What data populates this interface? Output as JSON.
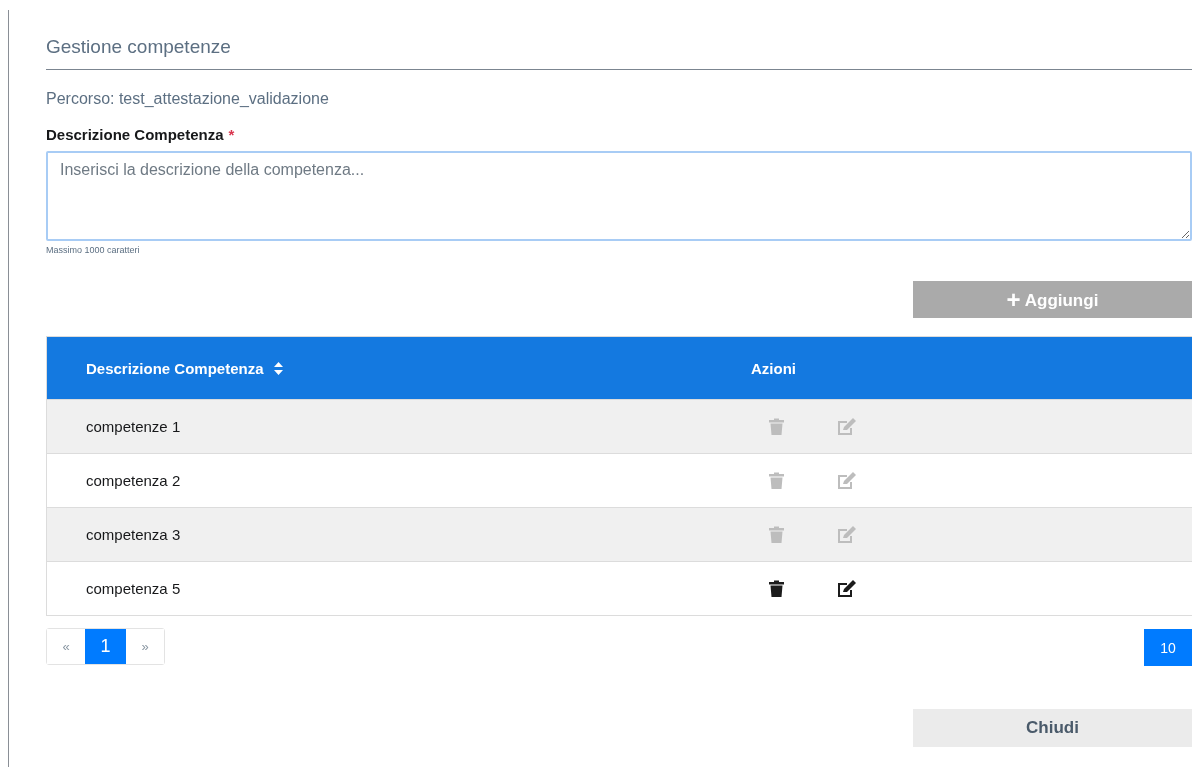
{
  "title": "Gestione competenze",
  "path_text": "Percorso: test_attestazione_validazione",
  "field": {
    "label": "Descrizione Competenza",
    "required_mark": "*",
    "placeholder": "Inserisci la descrizione della competenza...",
    "hint": "Massimo 1000 caratteri"
  },
  "add_button": {
    "icon": "+",
    "label": "Aggiungi",
    "disabled": true
  },
  "table": {
    "columns": [
      "Descrizione Competenza",
      "Azioni"
    ],
    "rows": [
      {
        "description": "competenze 1",
        "actions_disabled": true
      },
      {
        "description": "competenza 2",
        "actions_disabled": true
      },
      {
        "description": "competenza 3",
        "actions_disabled": true
      },
      {
        "description": "competenza 5",
        "actions_disabled": false
      }
    ]
  },
  "pagination": {
    "first": "«",
    "next": "»",
    "pages": [
      {
        "label": "1",
        "selected": true
      }
    ]
  },
  "page_size": "10",
  "close_button": "Chiudi"
}
